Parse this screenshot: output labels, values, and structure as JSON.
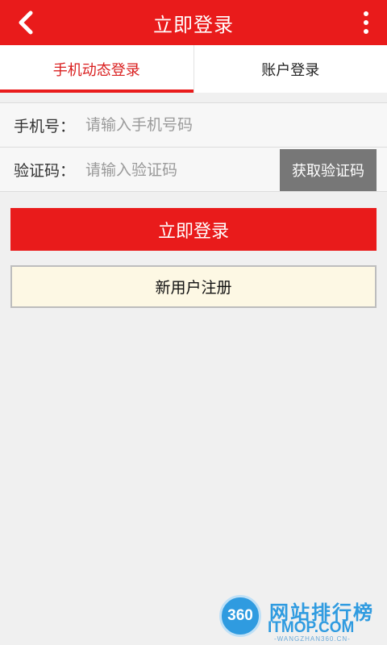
{
  "header": {
    "title": "立即登录",
    "back_icon": "chevron-left-icon",
    "menu_icon": "more-vertical-icon",
    "color": "#e91b1b"
  },
  "tabs": [
    {
      "label": "手机动态登录",
      "active": true
    },
    {
      "label": "账户登录",
      "active": false
    }
  ],
  "form": {
    "phone_label": "手机号：",
    "phone_placeholder": "请输入手机号码",
    "phone_value": "",
    "code_label": "验证码：",
    "code_placeholder": "请输入验证码",
    "code_value": "",
    "get_code_button": "获取验证码"
  },
  "actions": {
    "login_button": "立即登录",
    "register_button": "新用户注册"
  },
  "watermark": {
    "logo_text": "360",
    "name_cn": "网站排行榜",
    "name_en": "ITMOP.COM",
    "sub": "-WANGZHAN360.CN-"
  }
}
